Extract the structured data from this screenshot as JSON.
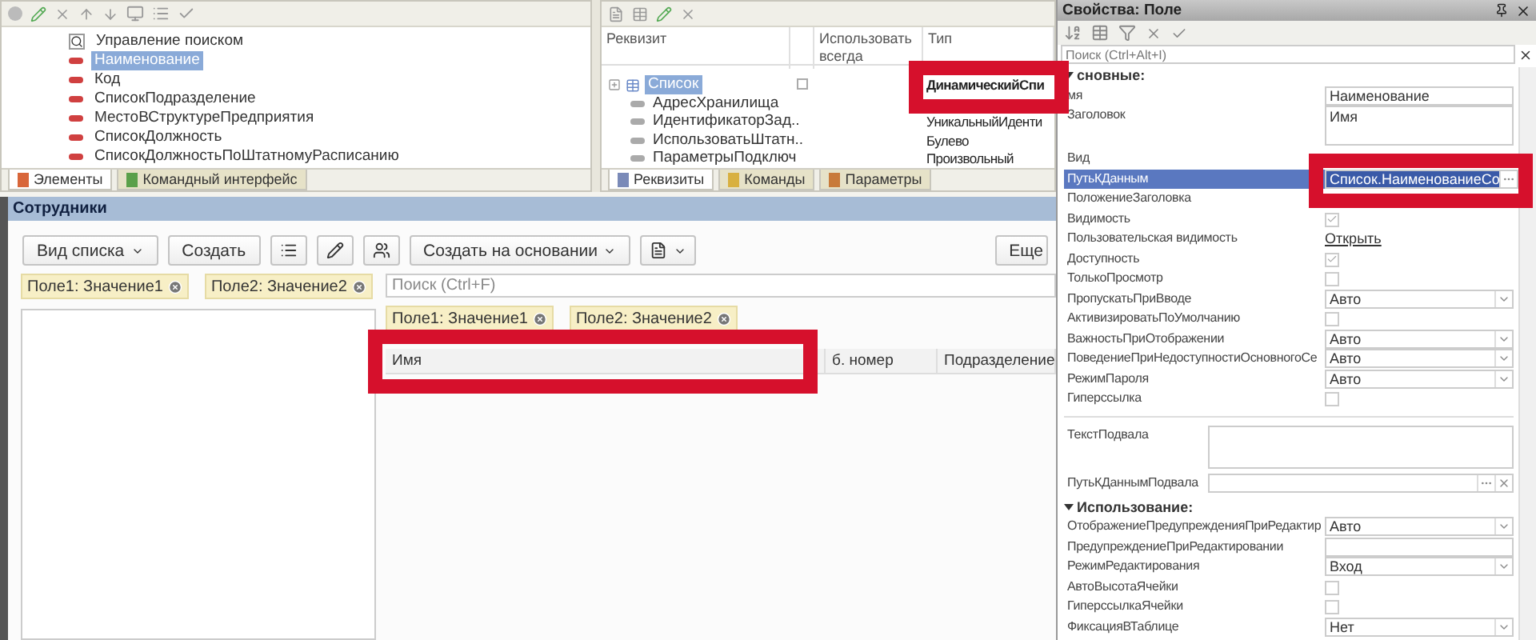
{
  "elements_pane": {
    "items": [
      {
        "kind": "search",
        "label": "Управление поиском",
        "selected": false
      },
      {
        "kind": "field",
        "label": "Наименование",
        "selected": true
      },
      {
        "kind": "field",
        "label": "Код",
        "selected": false
      },
      {
        "kind": "field",
        "label": "СписокПодразделение",
        "selected": false
      },
      {
        "kind": "field",
        "label": "МестоВСтруктуреПредприятия",
        "selected": false
      },
      {
        "kind": "field",
        "label": "СписокДолжность",
        "selected": false
      },
      {
        "kind": "field",
        "label": "СписокДолжностьПоШтатномуРасписанию",
        "selected": false
      }
    ],
    "tabs": [
      {
        "label": "Элементы",
        "selected": true
      },
      {
        "label": "Командный интерфейс",
        "selected": false
      }
    ]
  },
  "attributes_pane": {
    "columns": [
      "Реквизит",
      "Использовать всегда",
      "Тип"
    ],
    "rows": [
      {
        "kind": "table",
        "name": "Список",
        "type": "ДинамическийСпи",
        "selected": true,
        "checked": false
      },
      {
        "kind": "field",
        "name": "АдресХранилища",
        "selected": false
      },
      {
        "kind": "field",
        "name": "ИдентификаторЗад..",
        "type": "УникальныйИденти",
        "selected": false
      },
      {
        "kind": "field",
        "name": "ИспользоватьШтатн..",
        "type": "Булево",
        "selected": false
      },
      {
        "kind": "field",
        "name": "ПараметрыПодключ",
        "type": "Произвольный",
        "selected": false
      }
    ],
    "tabs": [
      {
        "label": "Реквизиты",
        "selected": true
      },
      {
        "label": "Команды",
        "selected": false
      },
      {
        "label": "Параметры",
        "selected": false
      }
    ]
  },
  "form": {
    "title": "Сотрудники",
    "commands": [
      {
        "kind": "menu",
        "label": "Вид списка"
      },
      {
        "kind": "button",
        "label": "Создать"
      },
      {
        "kind": "list"
      },
      {
        "kind": "pen"
      },
      {
        "kind": "users"
      },
      {
        "kind": "menu",
        "label": "Создать на основании"
      },
      {
        "kind": "doc-menu"
      },
      {
        "kind": "more",
        "label": "Еще"
      }
    ],
    "left_filters": [
      "Поле1: Значение1",
      "Поле2: Значение2"
    ],
    "search": {
      "placeholder": "Поиск (Ctrl+F)"
    },
    "filters": [
      "Поле1: Значение1",
      "Поле2: Значение2"
    ],
    "columns": [
      "Имя",
      "б. номер",
      "Подразделение"
    ]
  },
  "properties": {
    "title": "Свойства: Поле",
    "search": {
      "placeholder": "Поиск (Ctrl+Alt+I)"
    },
    "rows": [
      {
        "kind": "group",
        "label": "сновные:"
      },
      {
        "kind": "text",
        "label": "мя",
        "value": "Наименование"
      },
      {
        "kind": "textarea",
        "label": "Заголовок",
        "value": "Имя"
      },
      {
        "kind": "blank",
        "label": "Вид"
      },
      {
        "kind": "path",
        "label": "ПутьКДанным",
        "value": "Список.НаименованиеСо",
        "selected": true
      },
      {
        "kind": "blank",
        "label": "ПоложениеЗаголовка"
      },
      {
        "kind": "check",
        "label": "Видимость",
        "checked": true
      },
      {
        "kind": "link",
        "label": "Пользовательская видимость",
        "value": "Открыть"
      },
      {
        "kind": "check",
        "label": "Доступность",
        "checked": true
      },
      {
        "kind": "check",
        "label": "ТолькоПросмотр",
        "checked": false
      },
      {
        "kind": "select",
        "label": "ПропускатьПриВводе",
        "value": "Авто"
      },
      {
        "kind": "check",
        "label": "АктивизироватьПоУмолчанию",
        "checked": false
      },
      {
        "kind": "select",
        "label": "ВажностьПриОтображении",
        "value": "Авто"
      },
      {
        "kind": "select",
        "label": "ПоведениеПриНедоступностиОсновногоСе",
        "value": "Авто"
      },
      {
        "kind": "select",
        "label": "РежимПароля",
        "value": "Авто"
      },
      {
        "kind": "check",
        "label": "Гиперссылка",
        "checked": false
      },
      {
        "kind": "textarea-wide",
        "label": "ТекстПодвала"
      },
      {
        "kind": "path-wide",
        "label": "ПутьКДаннымПодвала"
      },
      {
        "kind": "group",
        "label": "Использование:"
      },
      {
        "kind": "select",
        "label": "ОтображениеПредупрежденияПриРедактир",
        "value": "Авто"
      },
      {
        "kind": "text",
        "label": "ПредупреждениеПриРедактировании"
      },
      {
        "kind": "select",
        "label": "РежимРедактирования",
        "value": "Вход"
      },
      {
        "kind": "check",
        "label": "АвтоВысотаЯчейки",
        "checked": false
      },
      {
        "kind": "check",
        "label": "ГиперссылкаЯчейки",
        "checked": false
      },
      {
        "kind": "select",
        "label": "ФиксацияВТаблице",
        "value": "Нет"
      }
    ]
  }
}
